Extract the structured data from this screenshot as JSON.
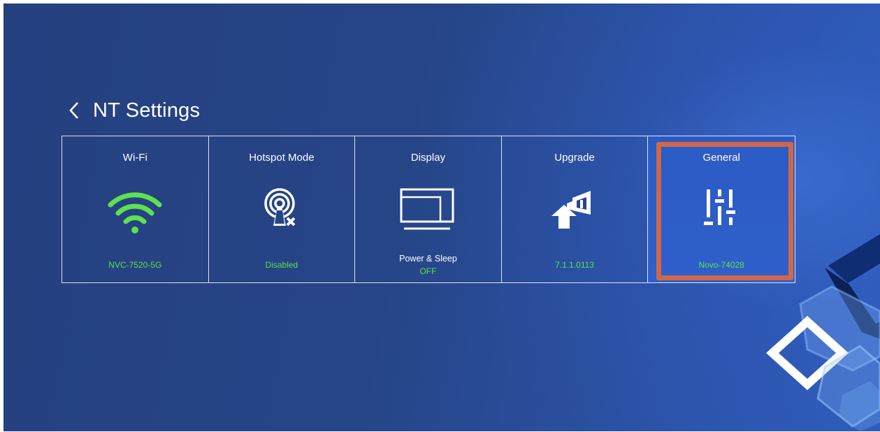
{
  "header": {
    "title": "NT Settings",
    "back_icon": "chevron-left-icon"
  },
  "colors": {
    "status_green": "#5fe04f",
    "selection_outline": "#d0674a"
  },
  "tiles": [
    {
      "label": "Wi-Fi",
      "icon": "wifi-icon",
      "status": "NVC-7520-5G"
    },
    {
      "label": "Hotspot Mode",
      "icon": "hotspot-disabled-icon",
      "status": "Disabled"
    },
    {
      "label": "Display",
      "icon": "display-icon",
      "sub_label": "Power & Sleep",
      "status": "OFF"
    },
    {
      "label": "Upgrade",
      "icon": "upgrade-icon",
      "status": "7.1.1.0113"
    },
    {
      "label": "General",
      "icon": "sliders-icon",
      "status": "Novo-74028",
      "selected": true
    }
  ]
}
